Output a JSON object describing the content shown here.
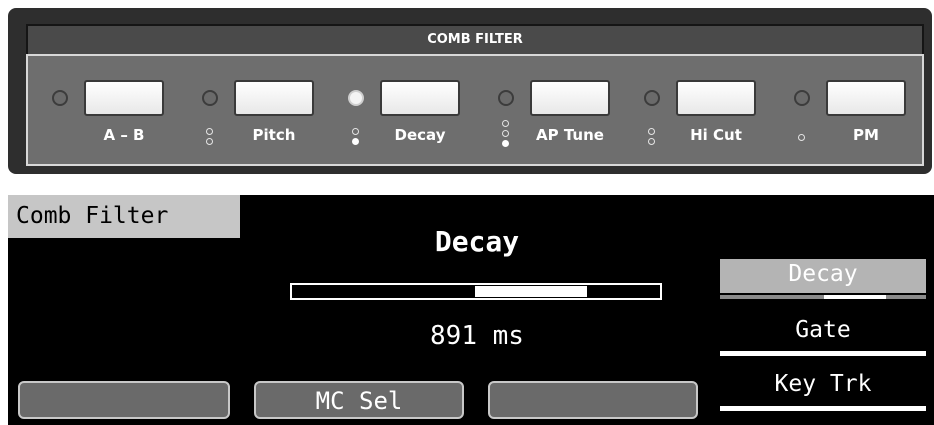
{
  "panel": {
    "title": "COMB FILTER",
    "buttons": [
      {
        "label": "A – B",
        "led_on": false
      },
      {
        "label": "Pitch",
        "led_on": false
      },
      {
        "label": "Decay",
        "led_on": true
      },
      {
        "label": "AP Tune",
        "led_on": false
      },
      {
        "label": "Hi Cut",
        "led_on": false
      },
      {
        "label": "PM",
        "led_on": false
      }
    ]
  },
  "display": {
    "tab_label": "Comb Filter",
    "param_title": "Decay",
    "param_value": "891 ms",
    "soft_buttons": [
      "",
      "MC Sel",
      ""
    ],
    "right_options": [
      {
        "label": "Decay",
        "selected": true
      },
      {
        "label": "Gate",
        "selected": false
      },
      {
        "label": "Key Trk",
        "selected": false
      }
    ]
  },
  "colors": {
    "panel_bg": "#2e2e2e",
    "panel_body": "#6e6e6e",
    "display_bg": "#000000",
    "tab_bg": "#c6c6c6",
    "soft_button": "#6a6a6a"
  }
}
